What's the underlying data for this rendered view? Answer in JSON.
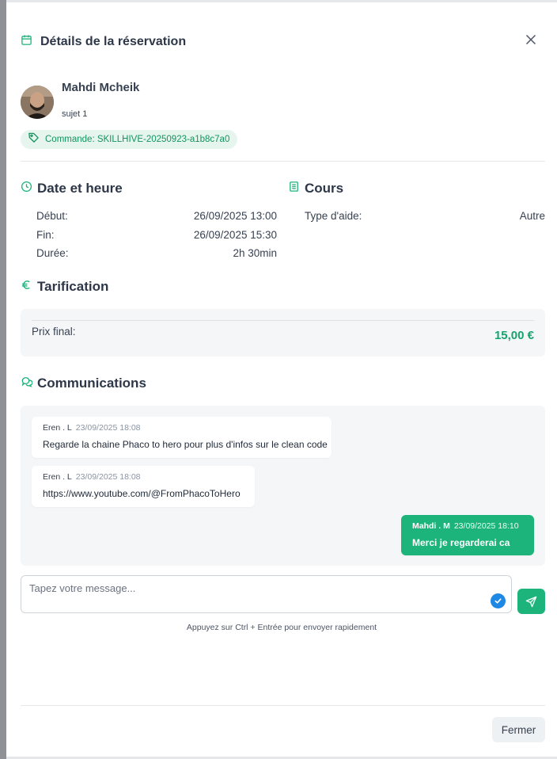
{
  "modal": {
    "title": "Détails de la réservation",
    "close_icon": "close-icon"
  },
  "user": {
    "name": "Mahdi Mcheik",
    "subject": "sujet 1"
  },
  "order": {
    "label": "Commande: SKILLHIVE-20250923-a1b8c7a0",
    "icon": "tag-icon"
  },
  "datetime": {
    "title": "Date et heure",
    "icon": "clock-icon",
    "rows": [
      {
        "label": "Début:",
        "value": "26/09/2025 13:00"
      },
      {
        "label": "Fin:",
        "value": "26/09/2025 15:30"
      },
      {
        "label": "Durée:",
        "value": "2h 30min"
      }
    ]
  },
  "course": {
    "title": "Cours",
    "icon": "book-icon",
    "rows": [
      {
        "label": "Type d'aide:",
        "value": "Autre"
      }
    ]
  },
  "pricing": {
    "title": "Tarification",
    "icon": "euro-icon",
    "final_label": "Prix final:",
    "final_value": "15,00 €"
  },
  "communications": {
    "title": "Communications",
    "icon": "chat-icon",
    "messages": [
      {
        "author": "Eren . L",
        "time": "23/09/2025 18:08",
        "text": "Regarde la chaine Phaco to hero pour plus d'infos sur le clean code",
        "mine": false
      },
      {
        "author": "Eren . L",
        "time": "23/09/2025 18:08",
        "text": "https://www.youtube.com/@FromPhacoToHero",
        "mine": false
      },
      {
        "author": "Mahdi . M",
        "time": "23/09/2025 18:10",
        "text": "Merci je regarderai ca",
        "mine": true
      }
    ],
    "input_placeholder": "Tapez votre message...",
    "input_value": "",
    "hint": "Appuyez sur Ctrl + Entrée pour envoyer rapidement",
    "send_icon": "send-icon",
    "check_icon": "check-circle-icon"
  },
  "footer": {
    "close_label": "Fermer"
  },
  "colors": {
    "accent": "#1cb47a",
    "accent_text": "#16a36d",
    "pill_bg": "#e6f6ef",
    "panel_bg": "#f4f6f8",
    "check_blue": "#1e88e5"
  }
}
